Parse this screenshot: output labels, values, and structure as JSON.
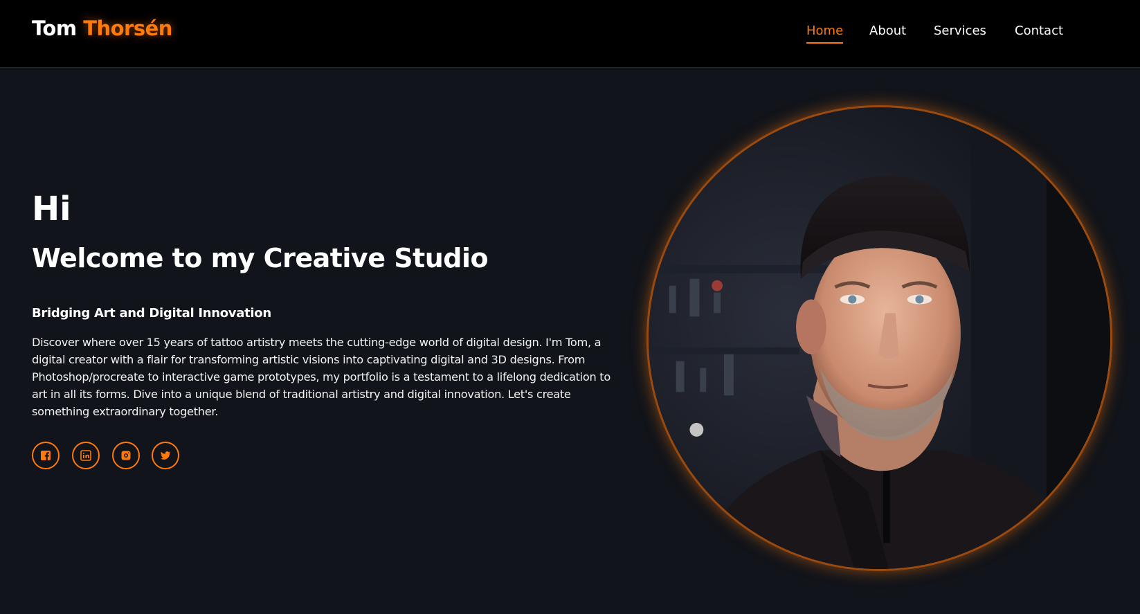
{
  "header": {
    "logo_first": "Tom",
    "logo_last": "Thorsén",
    "nav": [
      {
        "label": "Home",
        "active": true
      },
      {
        "label": "About",
        "active": false
      },
      {
        "label": "Services",
        "active": false
      },
      {
        "label": "Contact",
        "active": false
      }
    ]
  },
  "hero": {
    "greeting": "Hi",
    "headline": "Welcome to my Creative Studio",
    "tagline": "Bridging Art and Digital Innovation",
    "description": "Discover where over 15 years of tattoo artistry meets the cutting-edge world of digital design. I'm Tom, a digital creator with a flair for transforming artistic visions into captivating digital and 3D designs. From Photoshop/procreate to interactive game prototypes, my portfolio is a testament to a lifelong dedication to art in all its forms. Dive into a unique blend of traditional artistry and digital innovation. Let's create something extraordinary together."
  },
  "socials": [
    {
      "icon": "facebook-icon"
    },
    {
      "icon": "linkedin-icon"
    },
    {
      "icon": "instagram-icon"
    },
    {
      "icon": "twitter-icon"
    }
  ],
  "colors": {
    "accent": "#ff7a0a",
    "background": "#11141a",
    "header_background": "#000000",
    "text": "#ffffff"
  }
}
